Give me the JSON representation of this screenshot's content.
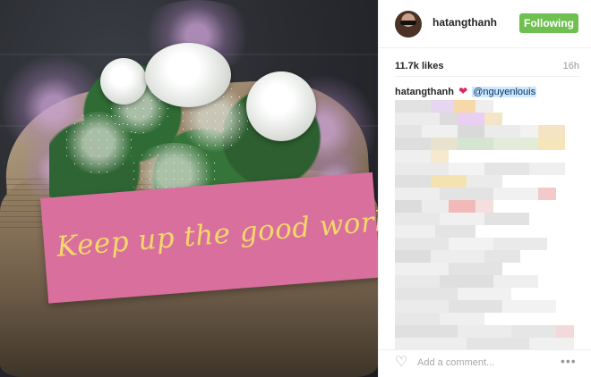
{
  "post": {
    "photo_icon": "bouquet-photo",
    "card_text": "Keep up the good work."
  },
  "header": {
    "username": "hatangthanh",
    "follow_label": "Following",
    "follow_color": "#70c050"
  },
  "stats": {
    "likes": "11.7k likes",
    "time": "16h"
  },
  "caption": {
    "author": "hatangthanh",
    "emoji": "❤",
    "mention": "@nguyenlouis"
  },
  "footer": {
    "comment_placeholder": "Add a comment...",
    "like_icon": "heart-outline-icon",
    "more_icon": "more-options-icon",
    "more_glyph": "•••"
  },
  "colors": {
    "accent": "#70c050",
    "mention_highlight": "#cfe6fb",
    "heart": "#e0245e"
  }
}
